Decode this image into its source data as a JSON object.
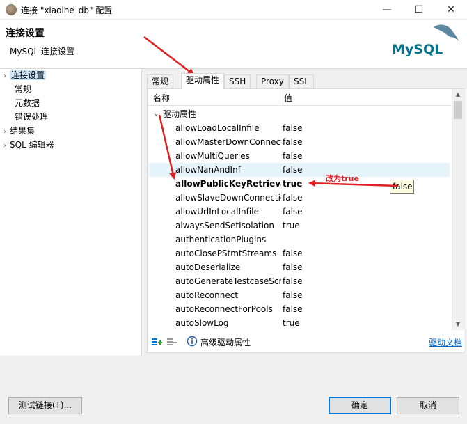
{
  "window": {
    "title": "连接 \"xiaolhe_db\" 配置",
    "minimize": "—",
    "maximize": "☐",
    "close": "✕"
  },
  "header": {
    "title": "连接设置",
    "subtitle": "MySQL 连接设置",
    "logo_text": "MySQL"
  },
  "nav": {
    "items": [
      {
        "label": "连接设置",
        "expandable": true,
        "selected": true
      },
      {
        "label": "常规",
        "expandable": false
      },
      {
        "label": "元数据",
        "expandable": false
      },
      {
        "label": "错误处理",
        "expandable": false
      },
      {
        "label": "结果集",
        "expandable": true
      },
      {
        "label": "SQL 编辑器",
        "expandable": true
      }
    ]
  },
  "tabs": [
    "常规",
    "驱动属性",
    "SSH",
    "Proxy",
    "SSL"
  ],
  "active_tab": "驱动属性",
  "table": {
    "col_name": "名称",
    "col_value": "值",
    "group": "驱动属性",
    "rows": [
      {
        "name": "allowLoadLocalInfile",
        "value": "false"
      },
      {
        "name": "allowMasterDownConnect",
        "value": "false"
      },
      {
        "name": "allowMultiQueries",
        "value": "false"
      },
      {
        "name": "allowNanAndInf",
        "value": "false",
        "highlight": true
      },
      {
        "name": "allowPublicKeyRetrieval",
        "value": "true",
        "bold": true
      },
      {
        "name": "allowSlaveDownConnectio",
        "value": "false"
      },
      {
        "name": "allowUrlInLocalInfile",
        "value": "false"
      },
      {
        "name": "alwaysSendSetIsolation",
        "value": "true"
      },
      {
        "name": "authenticationPlugins",
        "value": ""
      },
      {
        "name": "autoClosePStmtStreams",
        "value": "false"
      },
      {
        "name": "autoDeserialize",
        "value": "false"
      },
      {
        "name": "autoGenerateTestcaseScri",
        "value": "false"
      },
      {
        "name": "autoReconnect",
        "value": "false"
      },
      {
        "name": "autoReconnectForPools",
        "value": "false"
      },
      {
        "name": "autoSlowLog",
        "value": "true"
      }
    ]
  },
  "bottom": {
    "advanced_label": "高级驱动属性",
    "doc_link": "驱动文档"
  },
  "tooltip": "false",
  "annotation": "改为true",
  "footer": {
    "test_button": "测试链接(T)...",
    "ok_button": "确定",
    "cancel_button": "取消"
  },
  "colors": {
    "accent": "#0078d7",
    "annotation_red": "#e02020",
    "selection": "#cce8ff",
    "row_highlight": "#e5f3fb"
  }
}
